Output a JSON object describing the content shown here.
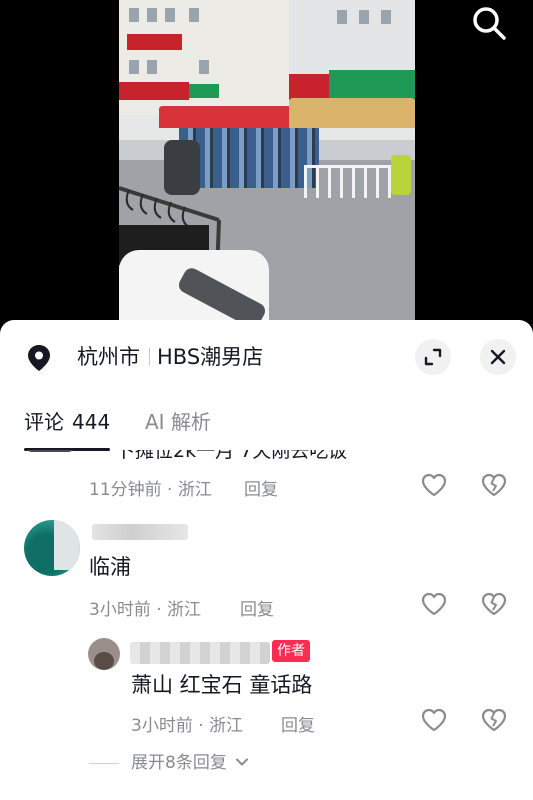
{
  "location": {
    "city": "杭州市",
    "shop": "HBS潮男店"
  },
  "tabs": {
    "comments_label": "评论",
    "comments_count": "444",
    "ai_label": "AI 解析"
  },
  "comments": [
    {
      "text_partial": "卜摊位2k一月 7天刚去吃饭",
      "time": "11分钟前",
      "region": "浙江",
      "reply": "回复"
    },
    {
      "author": "",
      "text": "临浦",
      "time": "3小时前",
      "region": "浙江",
      "reply": "回复",
      "replies": [
        {
          "author_badge": "作者",
          "text": "萧山 红宝石 童话路",
          "time": "3小时前",
          "region": "浙江",
          "reply": "回复"
        }
      ],
      "expand_label": "展开8条回复"
    }
  ],
  "meta_separator": " · ",
  "icons": [
    "search-icon",
    "location-pin-icon",
    "expand-icon",
    "close-icon",
    "like-icon",
    "dislike-icon",
    "chevron-down-icon"
  ],
  "colors": {
    "accent": "#fe2c55",
    "text_primary": "#161823",
    "text_secondary": "#8a8b91",
    "sheet_bg": "#ffffff"
  }
}
